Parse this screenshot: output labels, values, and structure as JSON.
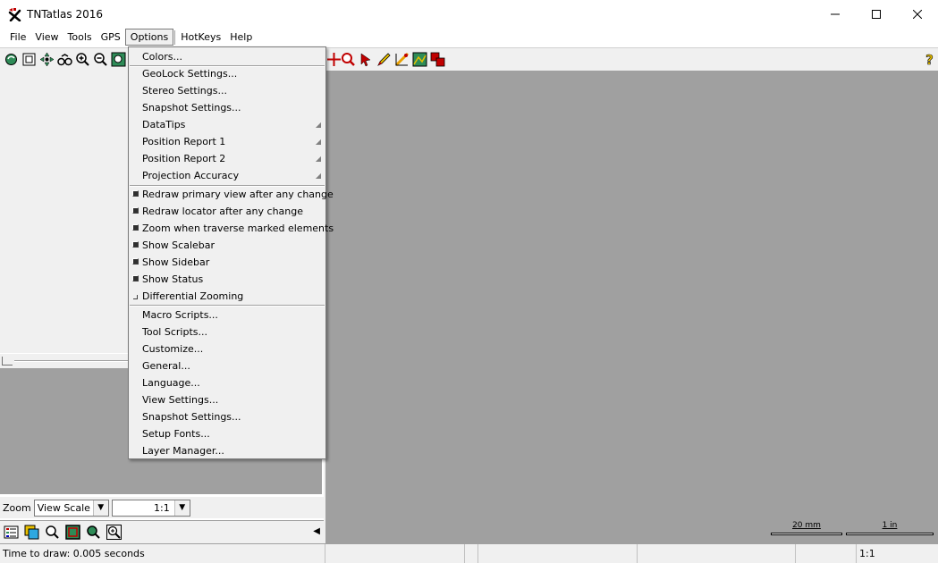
{
  "window": {
    "title": "TNTatlas 2016",
    "controls": {
      "minimize": "—",
      "maximize": "☐",
      "close": "✕"
    }
  },
  "menubar": {
    "items": [
      "File",
      "View",
      "Tools",
      "GPS",
      "Options",
      "HotKeys",
      "Help"
    ],
    "active": "Options"
  },
  "options_menu": {
    "section1": [
      "Colors..."
    ],
    "section2": [
      {
        "label": "GeoLock Settings...",
        "submenu": false
      },
      {
        "label": "Stereo Settings...",
        "submenu": false
      },
      {
        "label": "Snapshot Settings...",
        "submenu": false
      },
      {
        "label": "DataTips",
        "submenu": true
      },
      {
        "label": "Position Report 1",
        "submenu": true
      },
      {
        "label": "Position Report 2",
        "submenu": true
      },
      {
        "label": "Projection Accuracy",
        "submenu": true
      }
    ],
    "section3": [
      {
        "label": "Redraw primary view after any change",
        "checked": true
      },
      {
        "label": "Redraw locator after any change",
        "checked": true
      },
      {
        "label": "Zoom when traverse marked elements",
        "checked": true
      },
      {
        "label": "Show Scalebar",
        "checked": true
      },
      {
        "label": "Show Sidebar",
        "checked": true
      },
      {
        "label": "Show Status",
        "checked": true
      },
      {
        "label": "Differential Zooming",
        "checked": false
      }
    ],
    "section4": [
      "Macro Scripts...",
      "Tool Scripts...",
      "Customize...",
      "General...",
      "Language...",
      "View Settings...",
      "Snapshot Settings...",
      "Setup Fonts...",
      "Layer Manager..."
    ]
  },
  "zoom": {
    "label": "Zoom",
    "mode": "View Scale",
    "scale": "1:1"
  },
  "scalebars": {
    "metric": "20 mm",
    "imperial": "1 in"
  },
  "status": {
    "message": "Time to draw: 0.005 seconds",
    "scale": "1:1"
  },
  "colors": {
    "view_bg": "#a0a0a0",
    "chrome": "#f0f0f0"
  }
}
